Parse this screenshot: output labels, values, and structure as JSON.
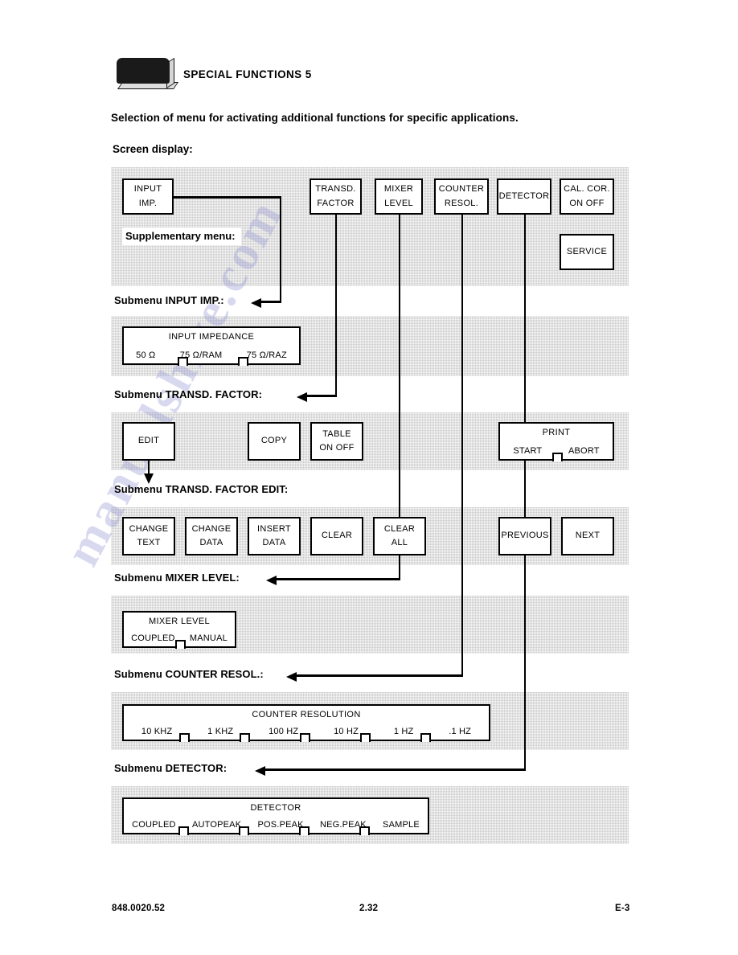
{
  "header": {
    "title": "SPECIAL FUNCTIONS 5",
    "intro": "Selection of menu for activating additional functions for specific applications.",
    "screen_display_label": "Screen display:"
  },
  "watermark": "manualshive.com",
  "main_menu": {
    "supplementary_label": "Supplementary menu:",
    "keys": [
      {
        "id": "input-imp",
        "lines": [
          "INPUT",
          "IMP."
        ]
      },
      {
        "id": "transd-factor",
        "lines": [
          "TRANSD.",
          "FACTOR"
        ]
      },
      {
        "id": "mixer-level",
        "lines": [
          "MIXER",
          "LEVEL"
        ]
      },
      {
        "id": "counter-resol",
        "lines": [
          "COUNTER",
          "RESOL."
        ]
      },
      {
        "id": "detector",
        "lines": [
          "DETECTOR"
        ]
      },
      {
        "id": "cal-cor",
        "lines": [
          "CAL. COR.",
          "ON   OFF"
        ]
      },
      {
        "id": "service",
        "lines": [
          "SERVICE"
        ]
      }
    ]
  },
  "captions": {
    "input_imp": "Submenu INPUT IMP.:",
    "transd_factor": "Submenu TRANSD. FACTOR:",
    "transd_factor_edit": "Submenu TRANSD. FACTOR EDIT:",
    "mixer_level": "Submenu MIXER LEVEL:",
    "counter_resol": "Submenu COUNTER RESOL.:",
    "detector": "Submenu DETECTOR:"
  },
  "submenus": {
    "input_impedance": {
      "title": "INPUT IMPEDANCE",
      "options": [
        "50 Ω",
        "75 Ω/RAM",
        "75 Ω/RAZ"
      ]
    },
    "transd_factor": {
      "keys": [
        {
          "id": "edit",
          "lines": [
            "EDIT"
          ]
        },
        {
          "id": "copy",
          "lines": [
            "COPY"
          ]
        },
        {
          "id": "table",
          "lines": [
            "TABLE",
            "ON   OFF"
          ]
        }
      ],
      "print": {
        "title": "PRINT",
        "options": [
          "START",
          "ABORT"
        ]
      }
    },
    "transd_factor_edit": {
      "keys": [
        {
          "id": "change-text",
          "lines": [
            "CHANGE",
            "TEXT"
          ]
        },
        {
          "id": "change-data",
          "lines": [
            "CHANGE",
            "DATA"
          ]
        },
        {
          "id": "insert-data",
          "lines": [
            "INSERT",
            "DATA"
          ]
        },
        {
          "id": "clear",
          "lines": [
            "CLEAR"
          ]
        },
        {
          "id": "clear-all",
          "lines": [
            "CLEAR",
            "ALL"
          ]
        },
        {
          "id": "previous",
          "lines": [
            "PREVIOUS"
          ]
        },
        {
          "id": "next",
          "lines": [
            "NEXT"
          ]
        }
      ]
    },
    "mixer_level": {
      "title": "MIXER LEVEL",
      "options": [
        "COUPLED",
        "MANUAL"
      ]
    },
    "counter_resolution": {
      "title": "COUNTER RESOLUTION",
      "options": [
        "10 KHZ",
        "1 KHZ",
        "100 HZ",
        "10 HZ",
        "1 HZ",
        ".1 HZ"
      ]
    },
    "detector": {
      "title": "DETECTOR",
      "options": [
        "COUPLED",
        "AUTOPEAK",
        "POS.PEAK",
        "NEG.PEAK",
        "SAMPLE"
      ]
    }
  },
  "footer": {
    "doc_number": "848.0020.52",
    "section": "2.32",
    "page": "E-3"
  }
}
